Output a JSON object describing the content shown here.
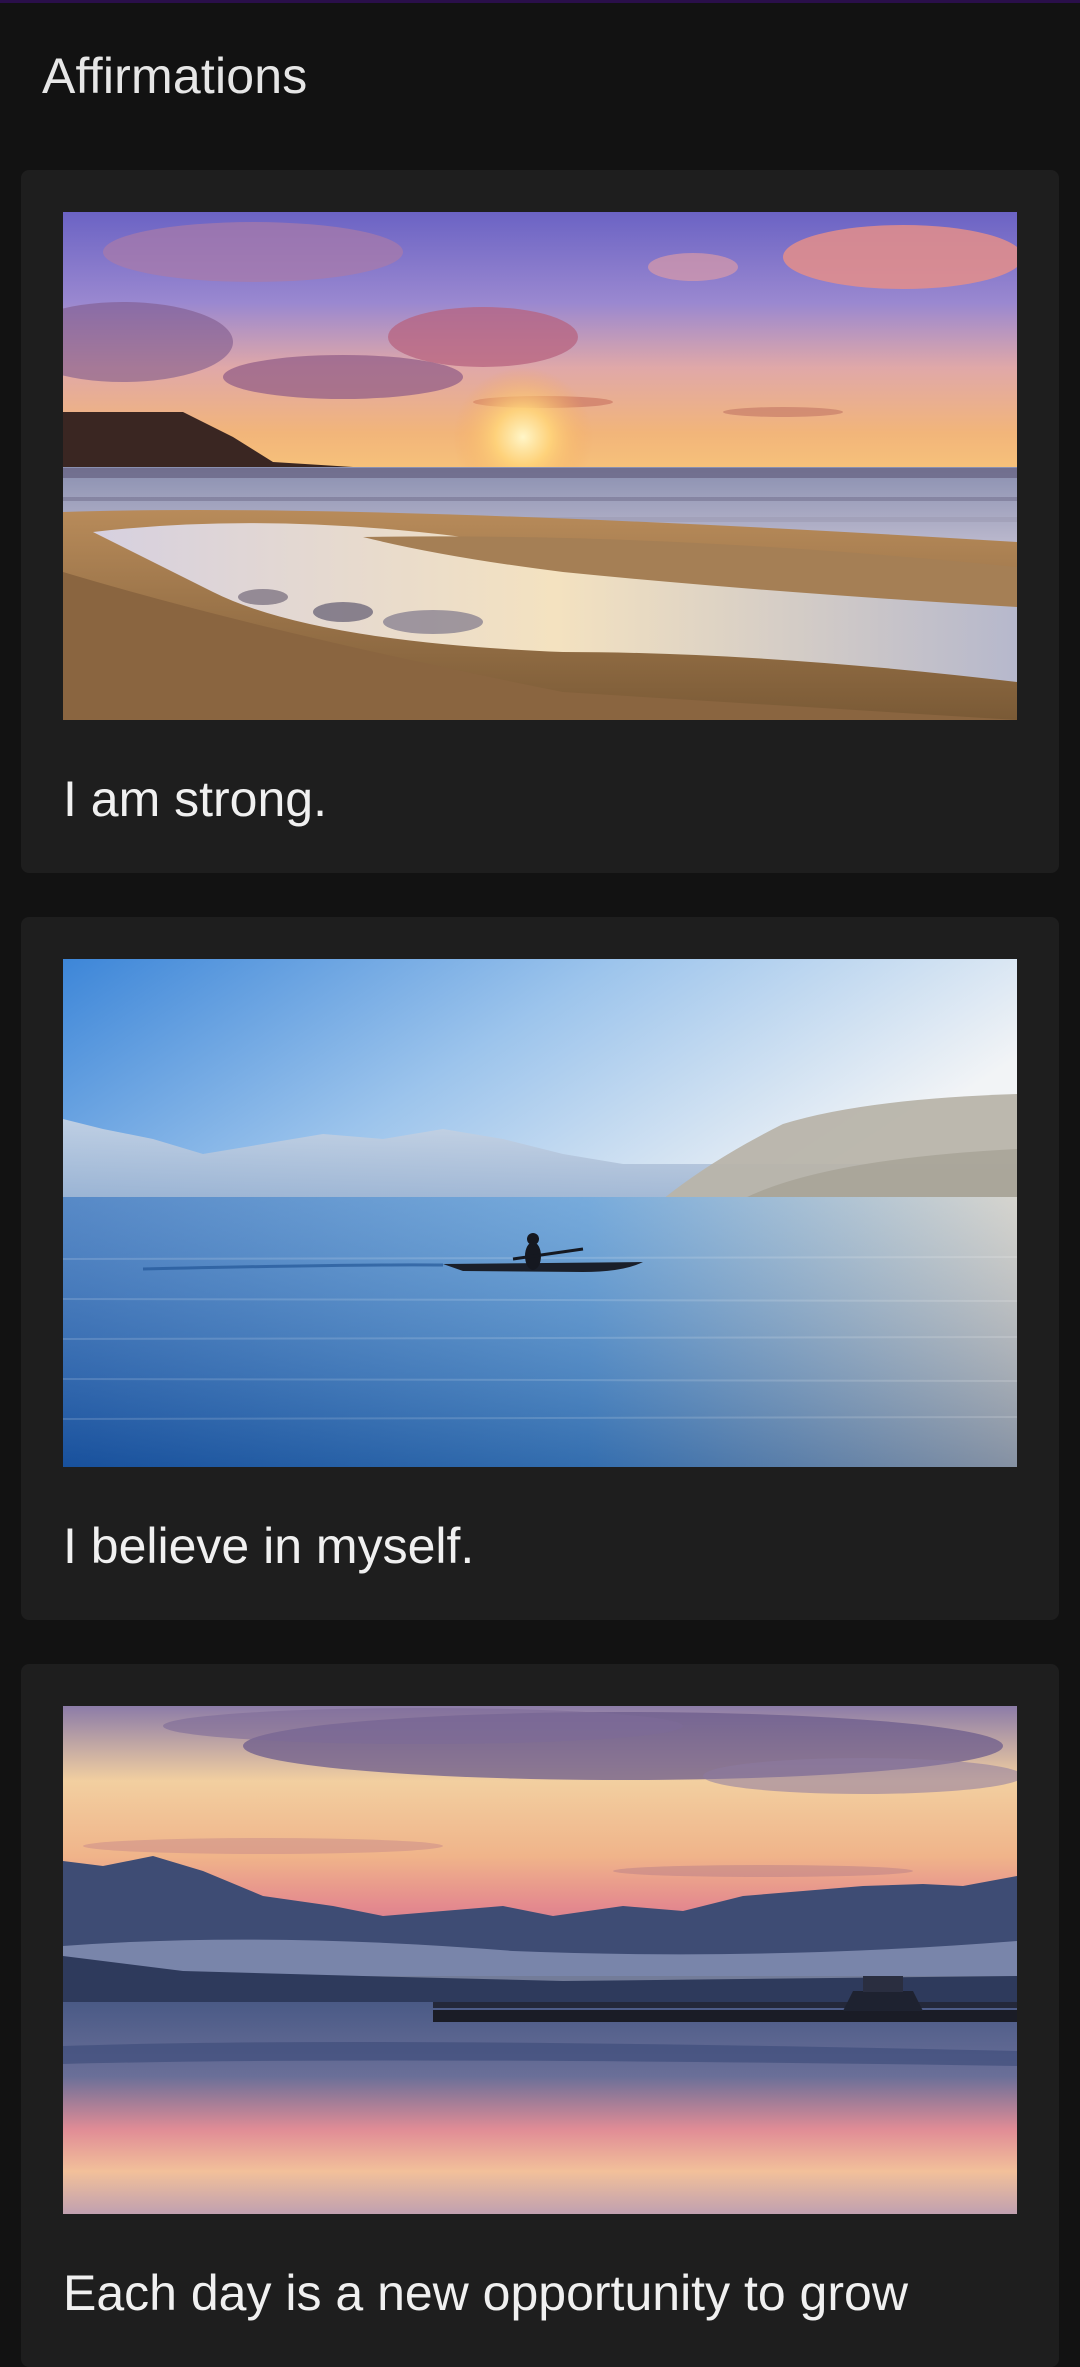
{
  "app_bar": {
    "title": "Affirmations"
  },
  "colors": {
    "background": "#121212",
    "card": "#1e1e1e",
    "text": "#f0f0f0",
    "status_strip": "#2a0f4a"
  },
  "affirmations": [
    {
      "text": "I am strong.",
      "image": "beach-sunset-image"
    },
    {
      "text": "I believe in myself.",
      "image": "lake-kayaker-image"
    },
    {
      "text": "Each day is a new opportunity to grow",
      "image": "mountain-lake-sunset-image"
    }
  ]
}
